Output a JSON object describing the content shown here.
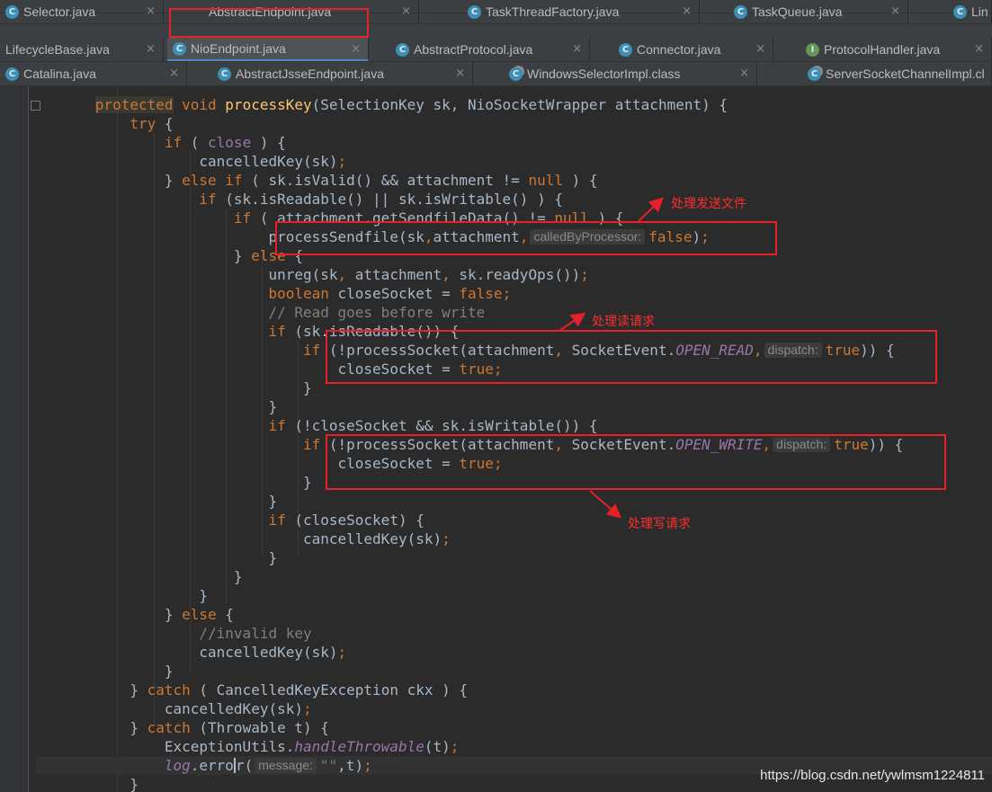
{
  "tabs": {
    "row1": [
      {
        "label": "LifecycleBase.java",
        "badge": "C",
        "active": false
      },
      {
        "label": "NioEndpoint.java",
        "badge": "C",
        "active": true
      },
      {
        "label": "AbstractProtocol.java",
        "badge": "C",
        "active": false
      },
      {
        "label": "Connector.java",
        "badge": "C",
        "active": false
      },
      {
        "label": "ProtocolHandler.java",
        "badge": "I",
        "active": false
      }
    ],
    "row2": [
      {
        "label": "Catalina.java",
        "badge": "C"
      },
      {
        "label": "AbstractJsseEndpoint.java",
        "badge": "C"
      },
      {
        "label": "WindowsSelectorImpl.class",
        "badge": "C"
      },
      {
        "label": "ServerSocketChannelImpl.cl",
        "badge": "C"
      }
    ],
    "row3": [
      {
        "label": "Selector.java",
        "badge": "C"
      },
      {
        "label": "AbstractEndpoint.java",
        "badge": "C"
      },
      {
        "label": "TaskThreadFactory.java",
        "badge": "C"
      },
      {
        "label": "TaskQueue.java",
        "badge": "C"
      },
      {
        "label": "Lin",
        "badge": "C"
      }
    ],
    "close_glyph": "×"
  },
  "code": {
    "l01": {
      "a": "protected",
      "b": " void ",
      "c": "processKey",
      "d": "(SelectionKey sk, NioSocketWrapper attachment) {"
    },
    "l02": {
      "a": "try",
      "b": " {"
    },
    "l03": {
      "a": "if",
      "b": " ( ",
      "c": "close",
      "d": " ) {"
    },
    "l04": {
      "a": "cancelledKey(sk)",
      "b": ";"
    },
    "l05": {
      "a": "} ",
      "b": "else if",
      "c": " ( sk.isValid() && attachment != ",
      "d": "null",
      "e": " ) {"
    },
    "l06": {
      "a": "if",
      "b": " (sk.isReadable() || sk.isWritable() ) {"
    },
    "l07": {
      "a": "if",
      "b": " ( attachment.getSendfileData() != ",
      "c": "null",
      "d": " ) {"
    },
    "l08": {
      "a": "processSendfile(sk",
      "b": ",",
      "c": "attachment",
      "d": ",",
      "hint": "calledByProcessor:",
      "e": "false",
      "f": ")",
      "g": ";"
    },
    "l09": {
      "a": "} ",
      "b": "else",
      "c": " {"
    },
    "l10": {
      "a": "unreg(sk",
      "b": ", ",
      "c": "attachment",
      "d": ", ",
      "e": "sk.readyOps())",
      "f": ";"
    },
    "l11": {
      "a": "boolean",
      "b": " closeSocket = ",
      "c": "false",
      "d": ";"
    },
    "l12": {
      "a": "// Read goes before write"
    },
    "l13": {
      "a": "if",
      "b": " (sk.isReadable()) {"
    },
    "l14": {
      "a": "if",
      "b": " (!processSocket(attachment",
      "c": ", ",
      "d": "SocketEvent.",
      "e": "OPEN_READ",
      "f": ",",
      "hint": "dispatch:",
      "g": "true",
      "h": ")) {"
    },
    "l15": {
      "a": "closeSocket = ",
      "b": "true",
      "c": ";"
    },
    "l16": {
      "a": "}"
    },
    "l17": {
      "a": "}"
    },
    "l18": {
      "a": "if",
      "b": " (!closeSocket && sk.isWritable()) {"
    },
    "l19": {
      "a": "if",
      "b": " (!processSocket(attachment",
      "c": ", ",
      "d": "SocketEvent.",
      "e": "OPEN_WRITE",
      "f": ",",
      "hint": "dispatch:",
      "g": "true",
      "h": ")) {"
    },
    "l20": {
      "a": "closeSocket = ",
      "b": "true",
      "c": ";"
    },
    "l21": {
      "a": "}"
    },
    "l22": {
      "a": "}"
    },
    "l23": {
      "a": "if",
      "b": " (closeSocket) {"
    },
    "l24": {
      "a": "cancelledKey(sk)",
      "b": ";"
    },
    "l25": {
      "a": "}"
    },
    "l26": {
      "a": "}"
    },
    "l27": {
      "a": "}"
    },
    "l28": {
      "a": "} ",
      "b": "else",
      "c": " {"
    },
    "l29": {
      "a": "//invalid key"
    },
    "l30": {
      "a": "cancelledKey(sk)",
      "b": ";"
    },
    "l31": {
      "a": "}"
    },
    "l32": {
      "a": "} ",
      "b": "catch",
      "c": " ( CancelledKeyException ckx ) {"
    },
    "l33": {
      "a": "cancelledKey(sk)",
      "b": ";"
    },
    "l34": {
      "a": "} ",
      "b": "catch",
      "c": " (Throwable t) {"
    },
    "l35": {
      "a": "ExceptionUtils.",
      "b": "handleThrowable",
      "c": "(t)",
      "d": ";"
    },
    "l36": {
      "a": "log",
      "b": ".",
      "c": "erro",
      "d": "r(",
      "hint": "message:",
      "e": "\"\"",
      "f": ",t)",
      "g": ";"
    },
    "l37": {
      "a": "}"
    }
  },
  "annotations": {
    "sendfile": "处理发送文件",
    "read": "处理读请求",
    "write": "处理写请求",
    "color": "#e8202a"
  },
  "watermark": "https://blog.csdn.net/ywlmsm1224811"
}
